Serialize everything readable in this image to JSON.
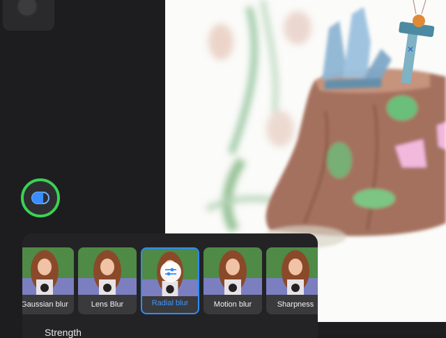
{
  "filters": [
    {
      "label": "Gaussian blur",
      "selected": false
    },
    {
      "label": "Lens Blur",
      "selected": false
    },
    {
      "label": "Radial blur",
      "selected": true
    },
    {
      "label": "Motion blur",
      "selected": false
    },
    {
      "label": "Sharpness",
      "selected": false
    }
  ],
  "adjust": {
    "label": "Strength"
  },
  "colors": {
    "accent": "#2f8cff",
    "compare_ring": "#39d353",
    "panel": "#232325"
  },
  "icons": {
    "compare": "split-toggle-icon",
    "adjust": "sliders-icon"
  }
}
